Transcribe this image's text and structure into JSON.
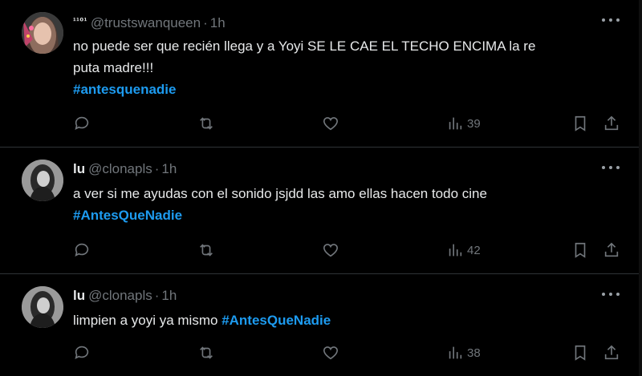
{
  "tweets": [
    {
      "display_name": "¹¹⁰¹",
      "handle": "@trustswanqueen",
      "sep": "·",
      "time": "1h",
      "text_lines": [
        "no puede ser que recién llega y a Yoyi SE LE CAE EL TECHO ENCIMA la re",
        "puta madre!!!"
      ],
      "hashtag": "#antesquenadie",
      "views": "39",
      "avatar_color": "#c0446a"
    },
    {
      "display_name": "lu",
      "handle": "@clonapls",
      "sep": "·",
      "time": "1h",
      "text": "a ver si me ayudas con el sonido jsjdd las amo ellas hacen todo cine",
      "hashtag": "#AntesQueNadie",
      "views": "42",
      "avatar_color": "#8a8a8a"
    },
    {
      "display_name": "lu",
      "handle": "@clonapls",
      "sep": "·",
      "time": "1h",
      "text": "limpien a yoyi ya mismo",
      "hashtag": "#AntesQueNadie",
      "views": "38",
      "avatar_color": "#8a8a8a"
    }
  ],
  "icons": [
    "reply-icon",
    "retweet-icon",
    "like-icon",
    "views-icon",
    "bookmark-icon",
    "share-icon",
    "more-icon"
  ],
  "colors": {
    "background": "#000000",
    "text": "#e7e9ea",
    "muted": "#71767b",
    "link": "#1d9bf0",
    "border": "#2f3336"
  }
}
